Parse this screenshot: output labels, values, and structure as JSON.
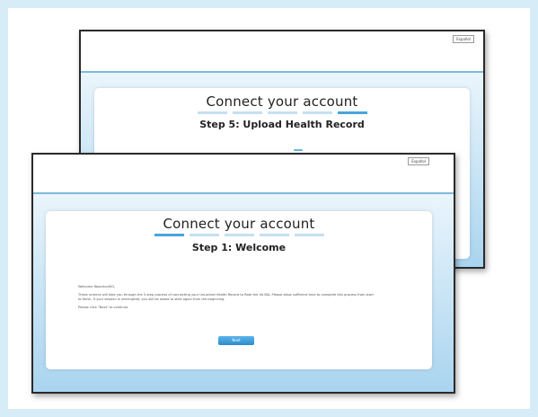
{
  "back_window": {
    "language_button": "Español",
    "title": "Connect your account",
    "step_title": "Step 5: Upload Health Record",
    "steps": [
      false,
      false,
      false,
      false,
      true
    ]
  },
  "front_window": {
    "language_button": "Español",
    "title": "Connect your account",
    "step_title": "Step 1: Welcome",
    "steps": [
      true,
      false,
      false,
      false,
      false
    ],
    "body": {
      "greeting": "Welcome ReportonSIG,",
      "paragraph": "These screens will take you through the 5-step process of connecting your UnLocked Health Record to Rate the VA IBA. Please allow sufficient time to complete this process from start to finish. If your session is interrupted, you will be asked to start again from the beginning.",
      "instruction": "Please click \"Next\" to continue."
    },
    "next_button": "Next"
  },
  "colors": {
    "accent": "#4aa3dc",
    "rule": "#7fb8de",
    "background": "#d6ecf7"
  }
}
